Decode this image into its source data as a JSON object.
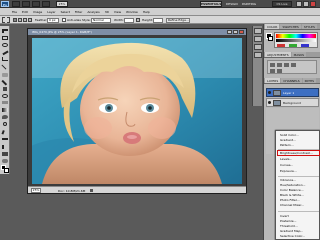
{
  "app": {
    "logo": "Ps",
    "zoom": "25%",
    "workspace_button": "ESSENTIALS",
    "workspace_tabs": [
      "DESIGN",
      "PAINTING"
    ],
    "cs_live": "CS Live"
  },
  "menu": [
    "File",
    "Edit",
    "Image",
    "Layer",
    "Select",
    "Filter",
    "Analysis",
    "3D",
    "View",
    "Window",
    "Help"
  ],
  "options_bar": {
    "feather_label": "Feather:",
    "feather_value": "0 px",
    "antialias_label": "Anti-alias",
    "style_label": "Style:",
    "style_value": "Normal",
    "width_label": "Width:",
    "height_label": "Height:",
    "refine_edge": "Refine Edge..."
  },
  "document": {
    "title": "IMG_0470.JPG @ 25% (Layer 1, RGB/8*)",
    "zoom_readout": "25%",
    "doc_size": "Doc: 10.8M/21.6M"
  },
  "panels": {
    "color_tabs": [
      "COLOR",
      "SWATCHES",
      "STYLES"
    ],
    "adjust_tabs": [
      "ADJUSTMENTS",
      "MASKS"
    ],
    "layers_tabs": [
      "LAYERS",
      "CHANNELS",
      "PATHS"
    ],
    "layers": [
      "Layer 1",
      "Background"
    ]
  },
  "adjustment_menu": {
    "items": [
      "Solid Color...",
      "Gradient...",
      "Pattern...",
      "Brightness/Contrast...",
      "Levels...",
      "Curves...",
      "Exposure...",
      "Vibrance...",
      "Hue/Saturation...",
      "Color Balance...",
      "Black & White...",
      "Photo Filter...",
      "Channel Mixer...",
      "Invert",
      "Posterize...",
      "Threshold...",
      "Gradient Map...",
      "Selective Color..."
    ],
    "highlighted_index": 3
  },
  "colors": {
    "app_bar": "#4a4a4a",
    "menu_bar": "#cfcfcf",
    "workspace_bg": "#5a5a5a",
    "selected_layer": "#3d6fc2",
    "highlight_outline": "#d01010"
  }
}
